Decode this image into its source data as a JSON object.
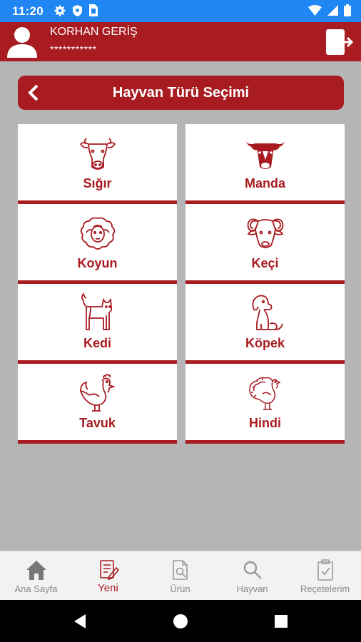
{
  "status": {
    "time": "11:20"
  },
  "user": {
    "name": "KORHAN GERİŞ",
    "password_mask": "***********"
  },
  "page": {
    "title": "Hayvan Türü Seçimi"
  },
  "animals": [
    {
      "label": "Sığır",
      "icon": "cow-icon"
    },
    {
      "label": "Manda",
      "icon": "buffalo-icon"
    },
    {
      "label": "Koyun",
      "icon": "sheep-icon"
    },
    {
      "label": "Keçi",
      "icon": "goat-icon"
    },
    {
      "label": "Kedi",
      "icon": "cat-icon"
    },
    {
      "label": "Köpek",
      "icon": "dog-icon"
    },
    {
      "label": "Tavuk",
      "icon": "chicken-icon"
    },
    {
      "label": "Hindi",
      "icon": "turkey-icon"
    }
  ],
  "bottom_nav": [
    {
      "label": "Ana Sayfa",
      "icon": "home-icon",
      "active": false
    },
    {
      "label": "Yeni",
      "icon": "new-document-icon",
      "active": true
    },
    {
      "label": "Ürün",
      "icon": "product-search-icon",
      "active": false
    },
    {
      "label": "Hayvan",
      "icon": "search-icon",
      "active": false
    },
    {
      "label": "Reçetelerim",
      "icon": "prescription-clipboard-icon",
      "active": false
    }
  ],
  "colors": {
    "primary": "#a81b21",
    "status_bar": "#1f86f3",
    "background": "#b5b5b5"
  }
}
